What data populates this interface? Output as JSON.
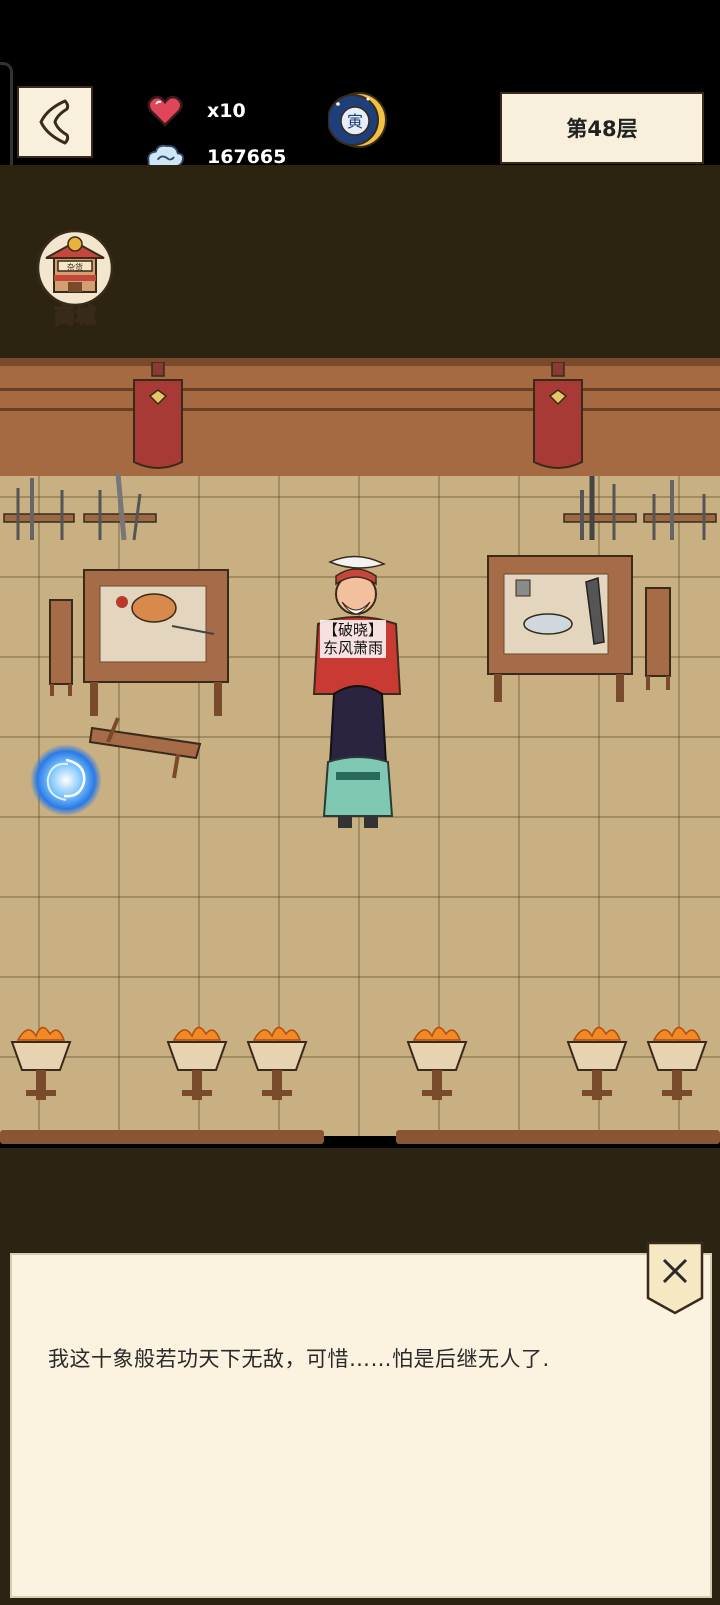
{
  "header": {
    "back_icon": "back-arrow-icon",
    "hearts": {
      "icon": "heart-icon",
      "value": "x10",
      "color": "#e0455a"
    },
    "coins": {
      "icon": "cloud-coin-icon",
      "value": "167665"
    },
    "zodiac": {
      "icon": "zodiac-tiger-moon-icon",
      "glyph": "寅"
    },
    "floor": "第48层"
  },
  "shop": {
    "icon": "shop-stall-icon",
    "sign": "杂货",
    "label": "商城"
  },
  "npc": {
    "title": "【破晓】",
    "name": "东风萧雨"
  },
  "dialog": {
    "text": "我这十象般若功天下无敌，可惜……怕是后继无人了.",
    "close_icon": "close-icon"
  },
  "colors": {
    "wall": "#a56a42",
    "floor": "#c9b083",
    "panel": "#fbf3e0",
    "background": "#2b2412"
  }
}
